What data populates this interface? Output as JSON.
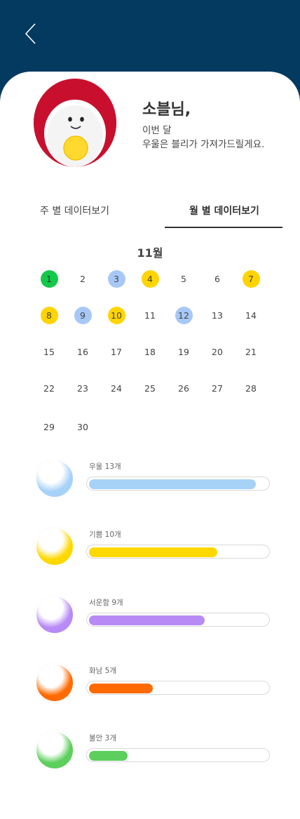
{
  "header": {
    "back_icon": "chevron-left-icon"
  },
  "profile": {
    "name": "소블님,",
    "message_line1": "이번 달",
    "message_line2": "우울은 블리가 가져가드릴게요."
  },
  "tabs": [
    {
      "label": "주 별 데이터보기",
      "active": false
    },
    {
      "label": "월 별 데이터보기",
      "active": true
    }
  ],
  "calendar": {
    "title": "11월",
    "days": [
      "1",
      "2",
      "3",
      "4",
      "5",
      "6",
      "7",
      "8",
      "9",
      "10",
      "11",
      "12",
      "13",
      "14",
      "15",
      "16",
      "17",
      "18",
      "19",
      "20",
      "21",
      "22",
      "23",
      "24",
      "25",
      "26",
      "27",
      "28",
      "29",
      "30"
    ],
    "marked": {
      "1": "#14c84a",
      "3": "#a7c8f6",
      "4": "#ffd400",
      "7": "#ffd400",
      "8": "#ffd400",
      "9": "#a7c8f6",
      "10": "#ffd400",
      "12": "#a7c8f6"
    }
  },
  "emotions": [
    {
      "label": "우울 13개",
      "count": 13,
      "color": "#a7d2f8"
    },
    {
      "label": "기쁨 10개",
      "count": 10,
      "color": "#ffd800"
    },
    {
      "label": "서운함 9개",
      "count": 9,
      "color": "#b78af5"
    },
    {
      "label": "화남 5개",
      "count": 5,
      "color": "#ff6a00"
    },
    {
      "label": "불안 3개",
      "count": 3,
      "color": "#5ccf5c"
    }
  ]
}
